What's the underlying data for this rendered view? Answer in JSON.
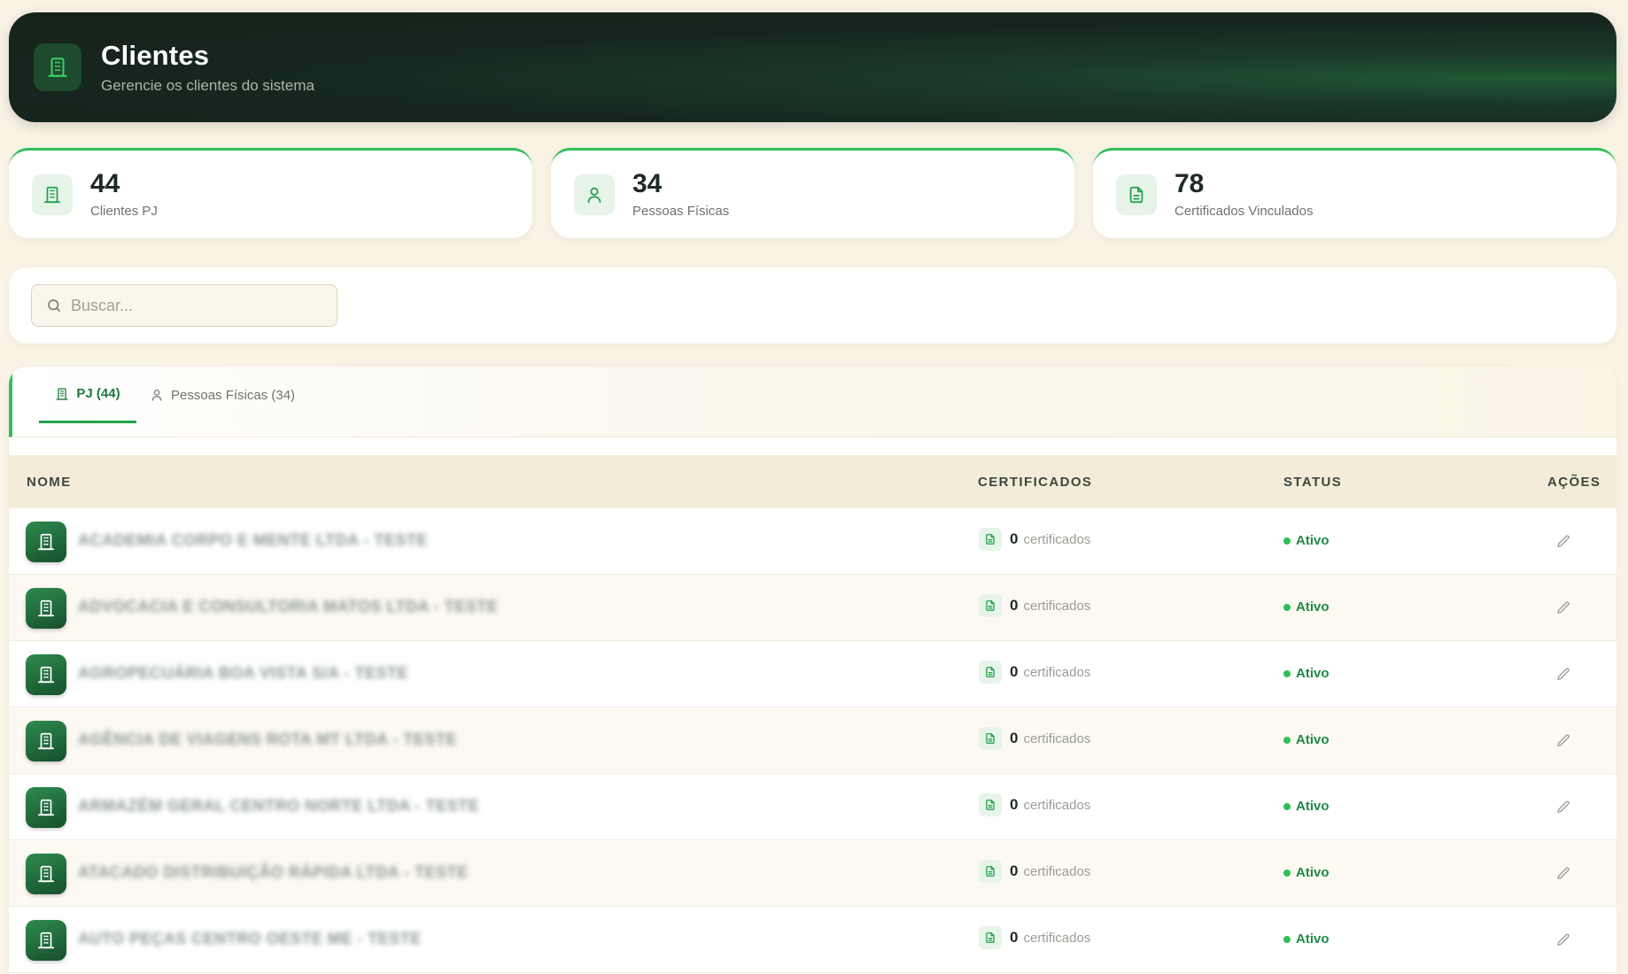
{
  "header": {
    "title": "Clientes",
    "subtitle": "Gerencie os clientes do sistema",
    "icon": "building-icon"
  },
  "stats": [
    {
      "value": "44",
      "label": "Clientes PJ",
      "icon": "building-icon"
    },
    {
      "value": "34",
      "label": "Pessoas Físicas",
      "icon": "user-icon"
    },
    {
      "value": "78",
      "label": "Certificados Vinculados",
      "icon": "document-icon"
    }
  ],
  "search": {
    "placeholder": "Buscar...",
    "value": ""
  },
  "tabs": [
    {
      "label": "PJ (44)",
      "active": true,
      "icon": "building-icon"
    },
    {
      "label": "Pessoas Físicas (34)",
      "active": false,
      "icon": "user-icon"
    }
  ],
  "table": {
    "columns": [
      "NOME",
      "CERTIFICADOS",
      "STATUS",
      "AÇÕES"
    ],
    "rows": [
      {
        "name": "ACADEMIA CORPO E MENTE LTDA - TESTE",
        "cert_count": "0",
        "cert_label": "certificados",
        "status": "Ativo"
      },
      {
        "name": "ADVOCACIA E CONSULTORIA MATOS LTDA - TESTE",
        "cert_count": "0",
        "cert_label": "certificados",
        "status": "Ativo"
      },
      {
        "name": "AGROPECUÁRIA BOA VISTA S/A - TESTE",
        "cert_count": "0",
        "cert_label": "certificados",
        "status": "Ativo"
      },
      {
        "name": "AGÊNCIA DE VIAGENS ROTA MT LTDA - TESTE",
        "cert_count": "0",
        "cert_label": "certificados",
        "status": "Ativo"
      },
      {
        "name": "ARMAZÉM GERAL CENTRO NORTE LTDA - TESTE",
        "cert_count": "0",
        "cert_label": "certificados",
        "status": "Ativo"
      },
      {
        "name": "ATACADO DISTRIBUIÇÃO RÁPIDA LTDA - TESTE",
        "cert_count": "0",
        "cert_label": "certificados",
        "status": "Ativo"
      },
      {
        "name": "AUTO PEÇAS CENTRO OESTE ME - TESTE",
        "cert_count": "0",
        "cert_label": "certificados",
        "status": "Ativo"
      }
    ]
  },
  "colors": {
    "accent": "#2fbf5a",
    "header_bg": "#16261f",
    "page_bg": "#f8f3e5",
    "status_active": "#1f8a45"
  }
}
